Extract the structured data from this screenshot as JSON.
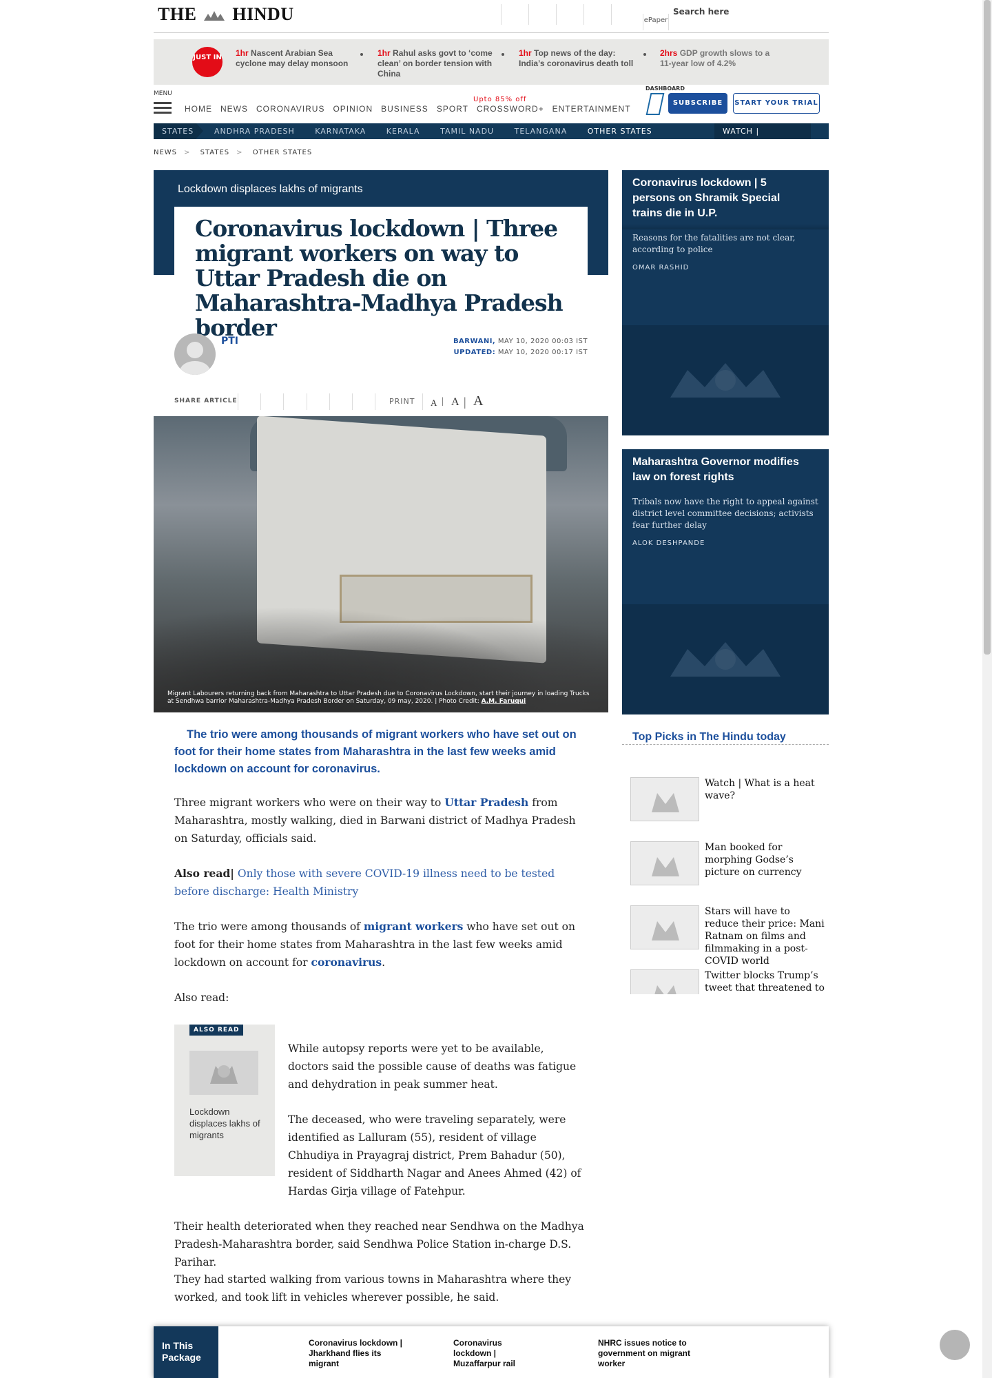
{
  "header": {
    "logo_left": "THE",
    "logo_right": "HINDU",
    "epaper": "ePaper",
    "search_placeholder": "Search here"
  },
  "just_in": {
    "badge": "JUST IN",
    "items": [
      {
        "time": "1hr",
        "text": "Nascent Arabian Sea cyclone may delay monsoon"
      },
      {
        "time": "1hr",
        "text": "Rahul asks govt to ‘come clean’ on border tension with China"
      },
      {
        "time": "1hr",
        "text": "Top news of the day: India’s coronavirus death toll overtakes China’s; those with"
      },
      {
        "time": "2hrs",
        "text": "GDP growth slows to a 11-year low of 4.2%"
      }
    ]
  },
  "nav": {
    "menu_label": "MENU",
    "items": [
      "HOME",
      "NEWS",
      "CORONAVIRUS",
      "OPINION",
      "BUSINESS",
      "SPORT",
      "CROSSWORD+",
      "ENTERTAINMENT"
    ],
    "promo": "Upto 85% off",
    "dashboard": "DASHBOARD",
    "subscribe": "SUBSCRIBE",
    "trial": "START YOUR TRIAL"
  },
  "states_bar": {
    "label": "STATES",
    "items": [
      "ANDHRA PRADESH",
      "KARNATAKA",
      "KERALA",
      "TAMIL NADU",
      "TELANGANA",
      "OTHER STATES"
    ],
    "watch": "WATCH | EXPLAINED"
  },
  "breadcrumb": [
    "NEWS",
    "STATES",
    "OTHER STATES"
  ],
  "article": {
    "kicker": "Lockdown displaces lakhs of migrants",
    "title": "Coronavirus lockdown | Three migrant workers on way to Uttar Pradesh die on Maharashtra-Madhya Pradesh border",
    "author": "PTI",
    "place": "BARWANI,",
    "date": "MAY 10, 2020 00:03 IST",
    "updated_label": "UPDATED:",
    "updated": "MAY 10, 2020 00:17 IST",
    "share_label": "SHARE ARTICLE",
    "print_label": "PRINT",
    "font_sizes": [
      "A",
      "A",
      "A"
    ],
    "caption": "Migrant Labourers returning back from Maharashtra to Uttar Pradesh due to Coronavirus Lockdown, start their journey in loading Trucks at Sendhwa barrior Maharashtra-Madhya Pradesh Border on Saturday, 09 may, 2020.",
    "photo_credit_label": "| Photo Credit:",
    "photo_credit": "A.M. Faruqui",
    "lead": "The trio were among thousands of migrant workers who have set out on foot for their home states from Maharashtra in the last few weeks amid lockdown on account for coronavirus.",
    "p1a": "Three migrant workers who were on their way to ",
    "p1link": "Uttar Pradesh",
    "p1b": " from Maharashtra, mostly walking, died in Barwani district of Madhya Pradesh on Saturday, officials said.",
    "also_read_label": "Also read|",
    "also_read_link": "Only those with severe COVID-19 illness need to be tested before discharge: Health Ministry",
    "p3a": "The trio were among thousands of ",
    "p3link1": "migrant workers",
    "p3b": " who have set out on foot for their home states from Maharashtra in the last few weeks amid lockdown on account for ",
    "p3link2": "coronavirus",
    "p3c": ".",
    "also_read2": "Also read:",
    "also_box_tag": "ALSO READ",
    "also_box_text": "Lockdown displaces lakhs of migrants",
    "p4": "While autopsy reports were yet to be available, doctors said the possible cause of deaths was fatigue and dehydration in peak summer heat.",
    "p5": "The deceased, who were traveling separately, were identified as Lalluram (55), resident of village Chhudiya in Prayagraj district, Prem Bahadur (50), resident of Siddharth Nagar and Anees Ahmed (42) of Hardas Girja village of Fatehpur.",
    "p6": "Their health deteriorated when they reached near Sendhwa on the Madhya Pradesh-Maharashtra border, said Sendhwa Police Station in-charge D.S. Parihar.",
    "p7": "They had started walking from various towns in Maharashtra where they worked, and took lift in vehicles wherever possible, he said."
  },
  "sidebar": {
    "cards": [
      {
        "title": "Coronavirus lockdown | 5 persons on Shramik Special trains die in U.P.",
        "desc": "Reasons for the fatalities are not clear, according to police",
        "author": "OMAR RASHID"
      },
      {
        "title": "Maharashtra Governor modifies law on forest rights",
        "desc": "Tribals now have the right to appeal against district level committee decisions; activists fear further delay",
        "author": "ALOK DESHPANDE"
      }
    ],
    "top_picks_title": "Top Picks in The Hindu today",
    "top_picks": [
      "Watch | What is a heat wave?",
      "Man booked for morphing Godse’s picture on currency",
      "Stars will have to reduce their price: Mani Ratnam on films and filmmaking in a post-COVID world",
      "Twitter blocks Trump’s tweet that threatened to"
    ]
  },
  "package": {
    "label": "In This Package",
    "items": [
      "Coronavirus lockdown | Jharkhand flies its migrant",
      "Coronavirus lockdown | Muzaffarpur rail",
      "NHRC issues notice to government on migrant worker"
    ]
  },
  "colors": {
    "navy": "#13385a",
    "accent_blue": "#1c4f9c",
    "red": "#e30c17"
  }
}
